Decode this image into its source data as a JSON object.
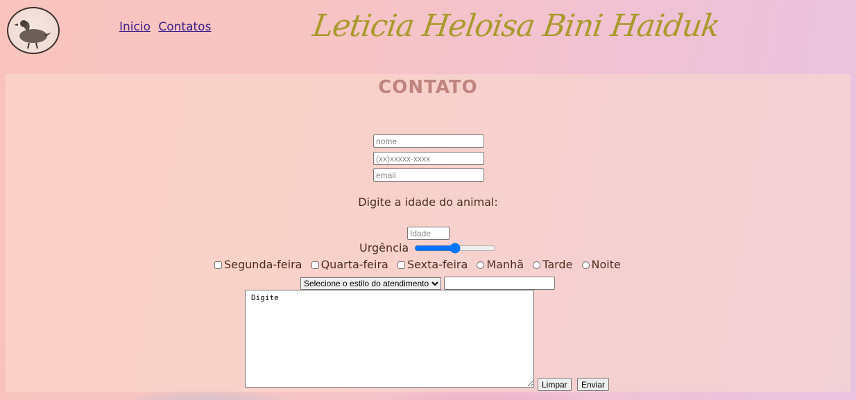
{
  "header": {
    "nav": [
      {
        "label": "Inicio"
      },
      {
        "label": "Contatos"
      }
    ],
    "brand": "Leticia Heloisa Bini Haiduk"
  },
  "form": {
    "title": "CONTATO",
    "nome_placeholder": "nome",
    "phone_placeholder": "(xx)xxxxx-xxxx",
    "email_placeholder": "email",
    "age_label": "Digite a idade do animal:",
    "age_placeholder": "Idade",
    "urgency_label": "Urgência",
    "urgency_value": 50,
    "days": [
      "Segunda-feira",
      "Quarta-feira",
      "Sexta-feira"
    ],
    "periods": [
      "Manhã",
      "Tarde",
      "Noite"
    ],
    "select_value": "Selecione o estilo do atendimento:",
    "textarea_value": "Digite",
    "reset_label": "Limpar",
    "submit_label": "Enviar"
  },
  "colors": {
    "title": "#c0847f",
    "brand": "#a99a2c",
    "link": "#3a1f86"
  }
}
